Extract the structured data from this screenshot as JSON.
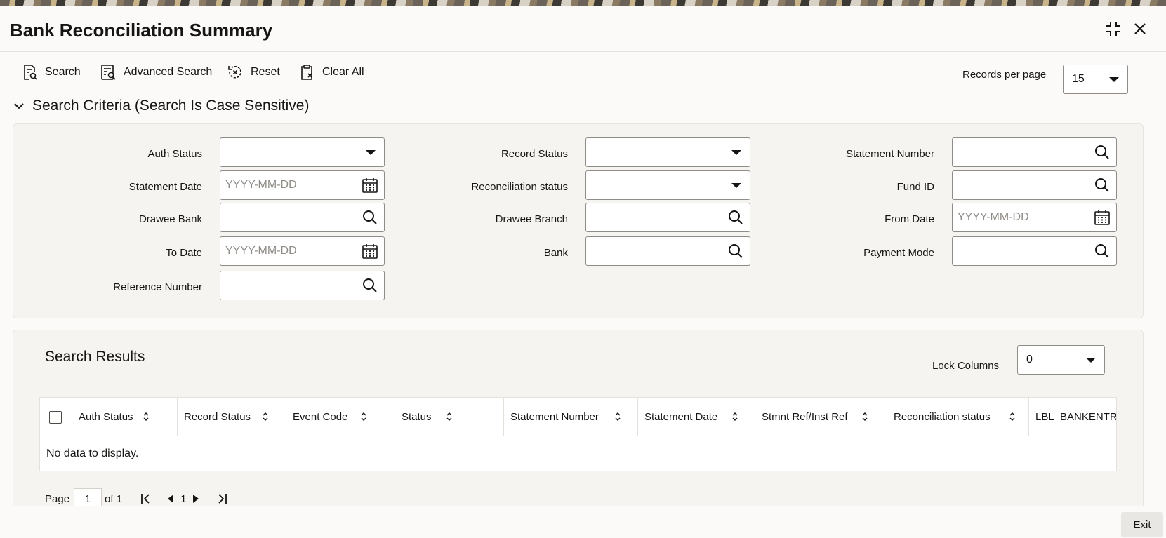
{
  "window": {
    "title": "Bank Reconciliation Summary"
  },
  "toolbar": {
    "search_label": "Search",
    "advanced_search_label": "Advanced Search",
    "reset_label": "Reset",
    "clear_all_label": "Clear All",
    "records_per_page_label": "Records per page",
    "records_per_page_value": "15"
  },
  "criteria": {
    "header": "Search Criteria (Search Is Case Sensitive)",
    "auth_status_label": "Auth Status",
    "auth_status_value": "",
    "record_status_label": "Record Status",
    "record_status_value": "",
    "statement_number_label": "Statement Number",
    "statement_number_value": "",
    "statement_date_label": "Statement Date",
    "statement_date_placeholder": "YYYY-MM-DD",
    "reconciliation_status_label": "Reconciliation status",
    "reconciliation_status_value": "",
    "fund_id_label": "Fund ID",
    "fund_id_value": "",
    "drawee_bank_label": "Drawee Bank",
    "drawee_bank_value": "",
    "drawee_branch_label": "Drawee Branch",
    "drawee_branch_value": "",
    "from_date_label": "From Date",
    "from_date_placeholder": "YYYY-MM-DD",
    "to_date_label": "To Date",
    "to_date_placeholder": "YYYY-MM-DD",
    "bank_label": "Bank",
    "bank_value": "",
    "payment_mode_label": "Payment Mode",
    "payment_mode_value": "",
    "reference_number_label": "Reference Number",
    "reference_number_value": ""
  },
  "results": {
    "title": "Search Results",
    "lock_columns_label": "Lock Columns",
    "lock_columns_value": "0",
    "columns": [
      "Auth Status",
      "Record Status",
      "Event Code",
      "Status",
      "Statement Number",
      "Statement Date",
      "Stmnt Ref/Inst Ref",
      "Reconciliation status",
      "LBL_BANKENTR"
    ],
    "empty_message": "No data to display."
  },
  "pager": {
    "page_label": "Page",
    "page_value": "1",
    "of_label": "of 1",
    "current_page": "1"
  },
  "footer": {
    "exit_label": "Exit"
  },
  "icons": {
    "maximize": "maximize-icon",
    "close": "close-icon",
    "search": "search-icon",
    "calendar": "calendar-icon",
    "sort": "sort-icon"
  }
}
